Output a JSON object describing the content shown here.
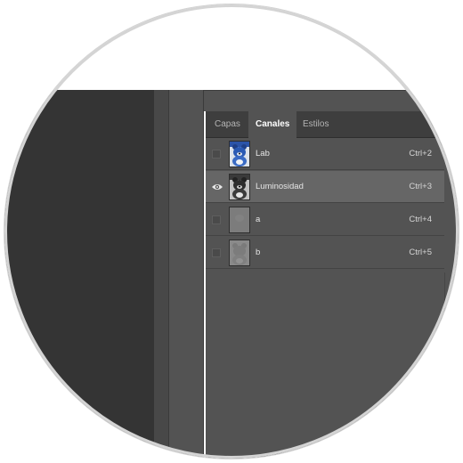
{
  "panel": {
    "tabs": [
      {
        "label": "Capas",
        "active": false
      },
      {
        "label": "Canales",
        "active": true
      },
      {
        "label": "Estilos",
        "active": false
      }
    ],
    "channels": [
      {
        "name": "Lab",
        "shortcut": "Ctrl+2",
        "visible": false,
        "selected": false,
        "thumbnail": "color-bear-icon"
      },
      {
        "name": "Luminosidad",
        "shortcut": "Ctrl+3",
        "visible": true,
        "selected": true,
        "thumbnail": "grayscale-bear-icon"
      },
      {
        "name": "a",
        "shortcut": "Ctrl+4",
        "visible": false,
        "selected": false,
        "thumbnail": "flat-gray-icon"
      },
      {
        "name": "b",
        "shortcut": "Ctrl+5",
        "visible": false,
        "selected": false,
        "thumbnail": "flat-gray-bear-icon"
      }
    ]
  },
  "colors": {
    "panel_bg": "#535353",
    "tabbar_bg": "#3e3e3e",
    "selected_row": "#666666",
    "canvas_bg": "#343434"
  }
}
